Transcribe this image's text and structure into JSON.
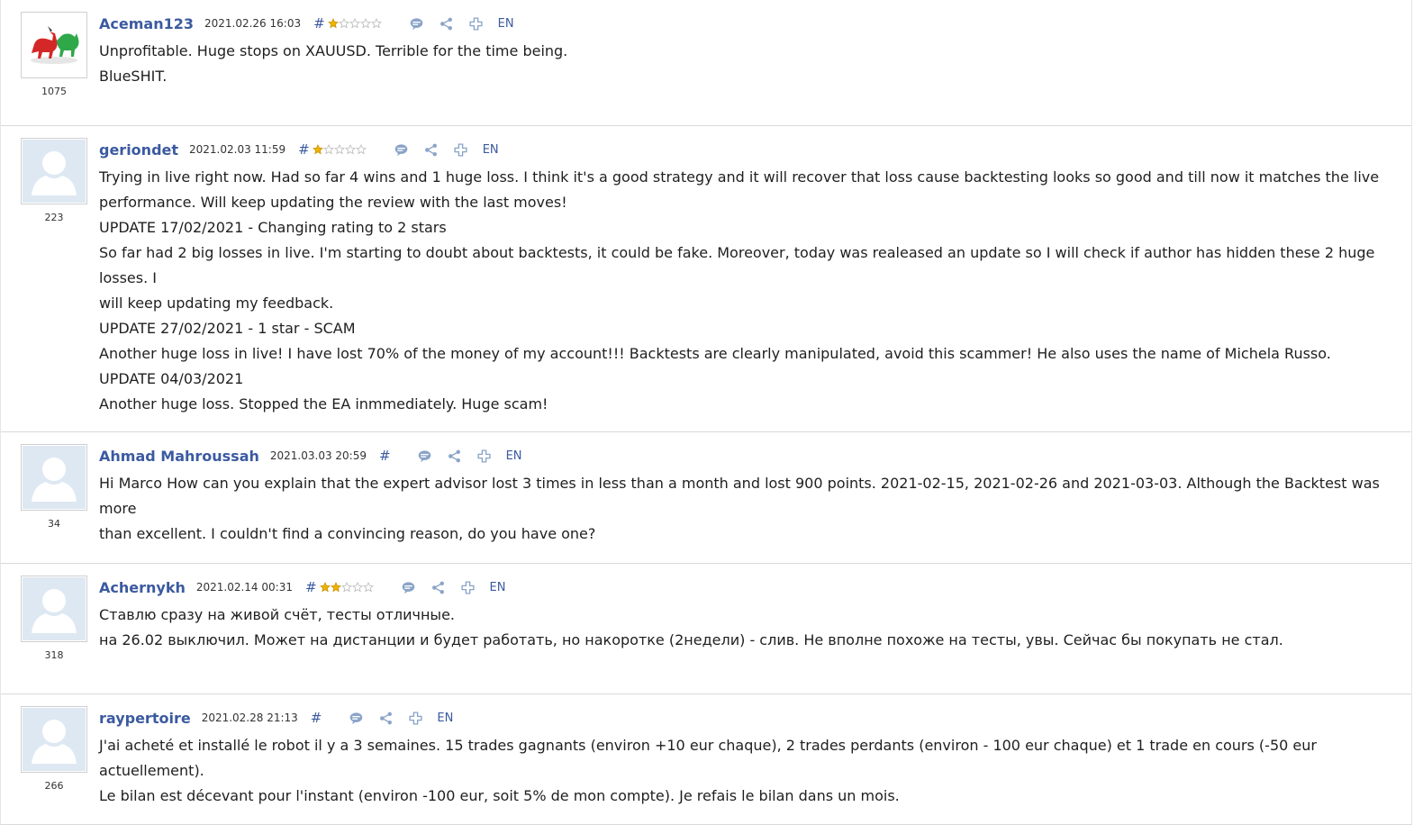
{
  "colors": {
    "author": "#3b5aa0",
    "star_filled": "#f0b400",
    "star_empty": "#b9b9b9",
    "icon": "#8aa4c8",
    "separator": "#d9d9d9"
  },
  "reviews": [
    {
      "author": "Aceman123",
      "date": "2021.02.26 16:03",
      "hash": "#",
      "stars": 1,
      "rating_count": "1075",
      "avatar": "bull-bear-icon",
      "lang": "EN",
      "lines": [
        "Unprofitable. Huge stops on XAUUSD. Terrible for the time being.",
        "BlueSHIT."
      ]
    },
    {
      "author": "geriondet",
      "date": "2021.02.03 11:59",
      "hash": "#",
      "stars": 1,
      "rating_count": "223",
      "avatar": "default-user-icon",
      "lang": "EN",
      "lines": [
        "Trying in live right now. Had so far 4 wins and 1 huge loss. I think it's a good strategy and it will recover that loss cause backtesting looks so good and till now it matches the live",
        "performance. Will keep updating the review with the last moves!",
        "UPDATE 17/02/2021 - Changing rating to 2 stars",
        "So far had 2 big losses in live. I'm starting to doubt about backtests, it could be fake. Moreover, today was realeased an update so I will check if author has hidden these 2 huge losses. I",
        "will keep updating my feedback.",
        "UPDATE 27/02/2021 - 1 star - SCAM",
        "Another huge loss in live! I have lost 70% of the money of my account!!! Backtests are clearly manipulated, avoid this scammer! He also uses the name of Michela Russo.",
        "UPDATE 04/03/2021",
        "Another huge loss. Stopped the EA inmmediately. Huge scam!"
      ]
    },
    {
      "author": "Ahmad Mahroussah",
      "date": "2021.03.03 20:59",
      "hash": "#",
      "stars": 0,
      "rating_count": "34",
      "avatar": "default-user-icon",
      "lang": "EN",
      "lines": [
        "Hi Marco How can you explain that the expert advisor lost 3 times in less than a month and lost 900 points. 2021-02-15, 2021-02-26 and 2021-03-03. Although the Backtest was more",
        "than excellent. I couldn't find a convincing reason, do you have one?"
      ]
    },
    {
      "author": "Achernykh",
      "date": "2021.02.14 00:31",
      "hash": "#",
      "stars": 2,
      "rating_count": "318",
      "avatar": "default-user-icon",
      "lang": "EN",
      "lines": [
        "Ставлю сразу на живой счёт, тесты отличные.",
        "на 26.02 выключил. Может на дистанции и будет работать, но накоротке (2недели) - слив. Не вполне похоже на тесты, увы. Сейчас бы покупать не стал."
      ]
    },
    {
      "author": "raypertoire",
      "date": "2021.02.28 21:13",
      "hash": "#",
      "stars": 0,
      "rating_count": "266",
      "avatar": "default-user-icon",
      "lang": "EN",
      "lines": [
        "J'ai acheté et installé le robot il y a 3 semaines. 15 trades gagnants (environ +10 eur chaque), 2 trades perdants (environ - 100 eur chaque) et 1 trade en cours (-50 eur actuellement).",
        "Le bilan est décevant pour l'instant (environ -100 eur, soit 5% de mon compte). Je refais le bilan dans un mois."
      ]
    }
  ]
}
